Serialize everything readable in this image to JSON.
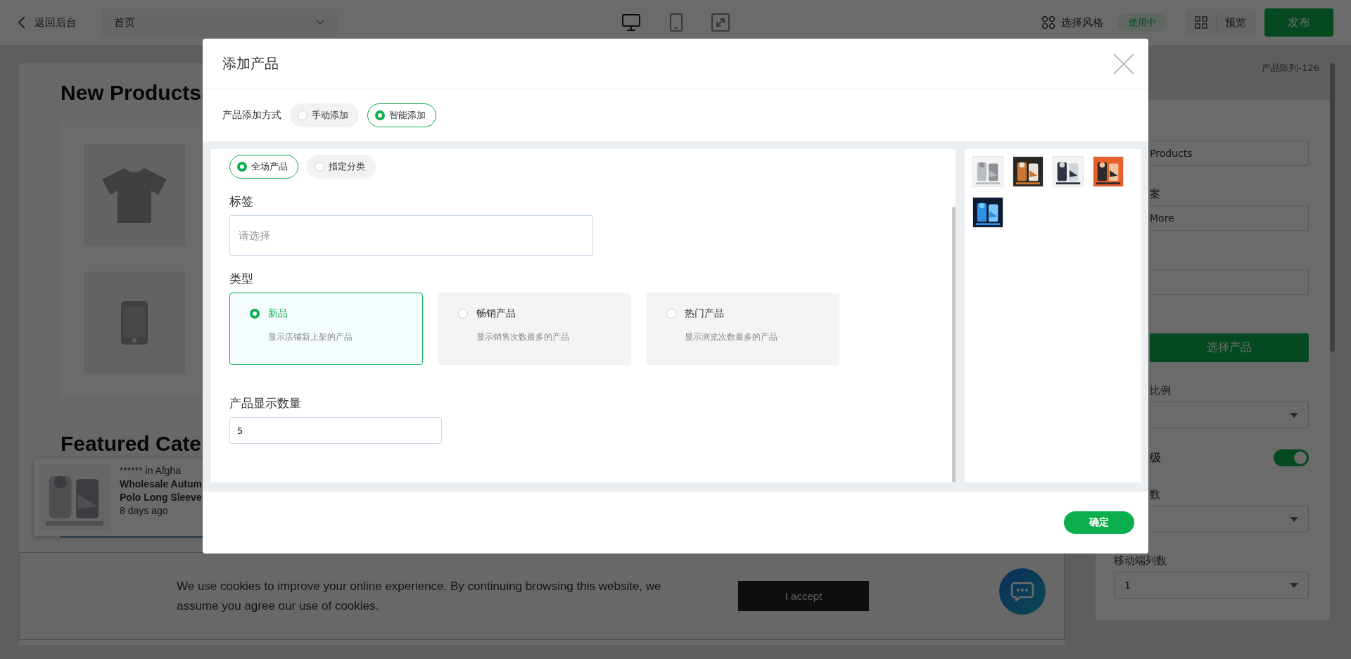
{
  "top_bar": {
    "back_link": "返回后台",
    "page_select": {
      "value": "首页"
    },
    "devices": [
      {
        "kind": "desktop",
        "selected": true
      },
      {
        "kind": "tablet",
        "selected": false
      },
      {
        "kind": "fullscreen",
        "selected": false
      }
    ],
    "style_button": "选择风格",
    "style_badge": "使用中",
    "preview_button": "预览",
    "publish_button": "发布"
  },
  "canvas": {
    "section_title": "New Products",
    "products": [
      {
        "kind": "tshirt"
      },
      {
        "kind": "phone"
      }
    ],
    "section_title_2": "Featured Cate",
    "notification": {
      "image": {
        "kind": "picture"
      },
      "location": "****** in Afgha",
      "title_lines": [
        "Wholesale Autum",
        "Polo Long Sleeve"
      ],
      "time": "8 days ago"
    },
    "cookie_notice": {
      "text": "We use cookies to improve your online experience. By continuing browsing this website, we assume you agree our use of cookies.",
      "button": "I accept"
    }
  },
  "side_panel": {
    "breadcrumb": "产品陈列-126",
    "items": [
      {
        "kind": "field",
        "value": "Products"
      },
      {
        "kind": "label",
        "text": "案"
      },
      {
        "kind": "field",
        "value": "More"
      },
      {
        "kind": "field"
      },
      {
        "kind": "button",
        "text": "选择产品"
      },
      {
        "kind": "label",
        "text": "比例"
      },
      {
        "kind": "select"
      },
      {
        "kind": "toggle",
        "text": "级",
        "on": true
      },
      {
        "kind": "label",
        "text": "数"
      },
      {
        "kind": "select"
      },
      {
        "kind": "label",
        "text": "移动端列数"
      },
      {
        "kind": "select",
        "value": "1"
      }
    ]
  },
  "modal": {
    "title": "添加产品",
    "method_label": "产品添加方式",
    "methods": [
      {
        "label": "手动添加",
        "selected": false
      },
      {
        "label": "智能添加",
        "selected": true
      }
    ],
    "scopes": [
      {
        "label": "全场产品",
        "selected": true
      },
      {
        "label": "指定分类",
        "selected": false
      }
    ],
    "tag_label": "标签",
    "tag_field": {
      "placeholder": "请选择"
    },
    "type_label": "类型",
    "types": [
      {
        "title": "新品",
        "description": "显示店铺新上架的产品",
        "selected": true
      },
      {
        "title": "畅销产品",
        "description": "显示销售次数最多的产品",
        "selected": false
      },
      {
        "title": "热门产品",
        "description": "显示浏览次数最多的产品",
        "selected": false
      }
    ],
    "count_label": "产品显示数量",
    "count_field": {
      "value": "5"
    },
    "preview_products": [
      {
        "kind": "picture"
      },
      {
        "kind": "picture"
      },
      {
        "kind": "picture"
      },
      {
        "kind": "picture"
      },
      {
        "kind": "picture"
      }
    ],
    "confirm_button": "确定"
  }
}
